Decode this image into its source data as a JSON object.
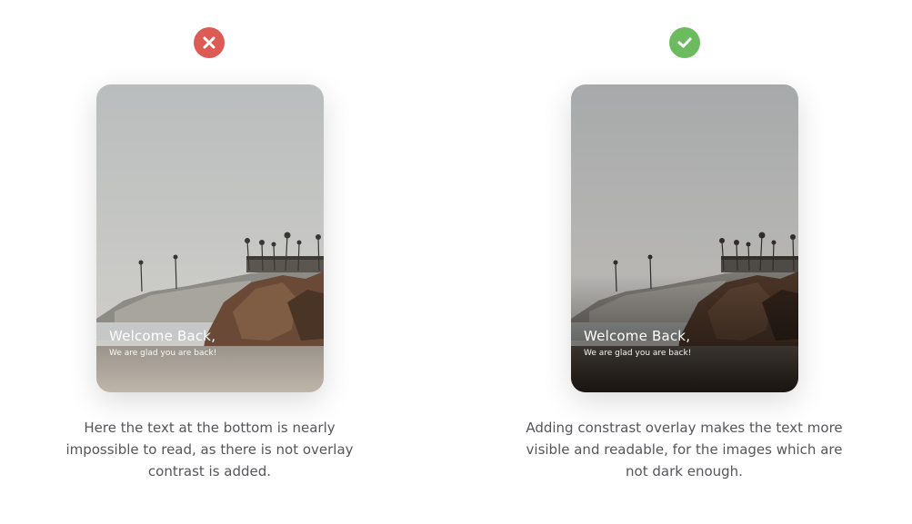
{
  "colors": {
    "bad": "#dc5b55",
    "good": "#6cbc5f",
    "caption_text": "#55565a",
    "card_text": "#ffffff"
  },
  "examples": [
    {
      "status": "bad",
      "status_icon": "close-icon",
      "card": {
        "title": "Welcome Back,",
        "subtitle": "We are glad you are back!",
        "overlay": false
      },
      "caption_lines": [
        "Here the text at the bottom is nearly",
        "impossible to read, as there is not overlay",
        "contrast is added."
      ]
    },
    {
      "status": "good",
      "status_icon": "check-icon",
      "card": {
        "title": "Welcome Back,",
        "subtitle": "We are glad you are back!",
        "overlay": true
      },
      "caption_lines": [
        "Adding constrast overlay makes the text more",
        "visible and readable, for the images which are",
        "not dark enough."
      ]
    }
  ]
}
